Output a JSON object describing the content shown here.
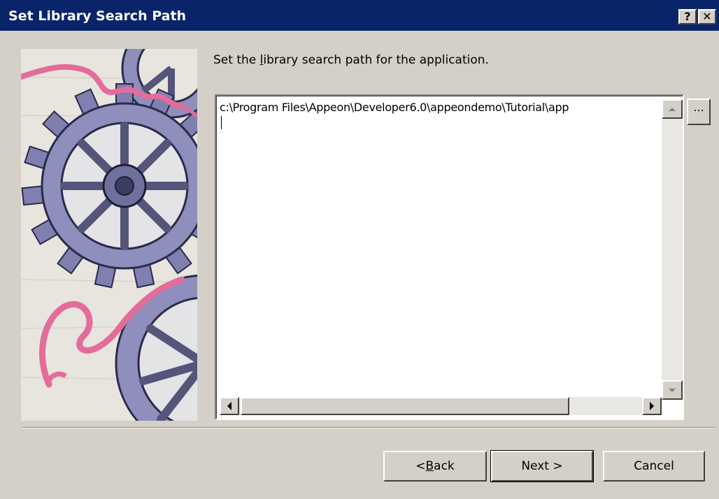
{
  "window": {
    "title": "Set Library Search Path",
    "help_glyph": "?",
    "close_glyph": "✕"
  },
  "instruction": {
    "pre": "Set the ",
    "accel": "l",
    "post": "ibrary search path for the application."
  },
  "path_field": {
    "value": "c:\\Program Files\\Appeon\\Developer6.0\\appeondemo\\Tutorial\\app"
  },
  "browse_button": {
    "label": "..."
  },
  "buttons": {
    "back": {
      "pre": "< ",
      "accel": "B",
      "post": "ack"
    },
    "next": {
      "label": "Next >"
    },
    "cancel": {
      "label": "Cancel"
    }
  },
  "colors": {
    "title_bar": "#0a246a",
    "dialog_face": "#d4d0c8",
    "gear": "#8e8fbc",
    "ribbon": "#e36c9a"
  },
  "icons": {
    "up": "scroll-up-arrow-icon",
    "down": "scroll-down-arrow-icon",
    "left": "scroll-left-arrow-icon",
    "right": "scroll-right-arrow-icon",
    "art": "gears-wizard-illustration"
  }
}
